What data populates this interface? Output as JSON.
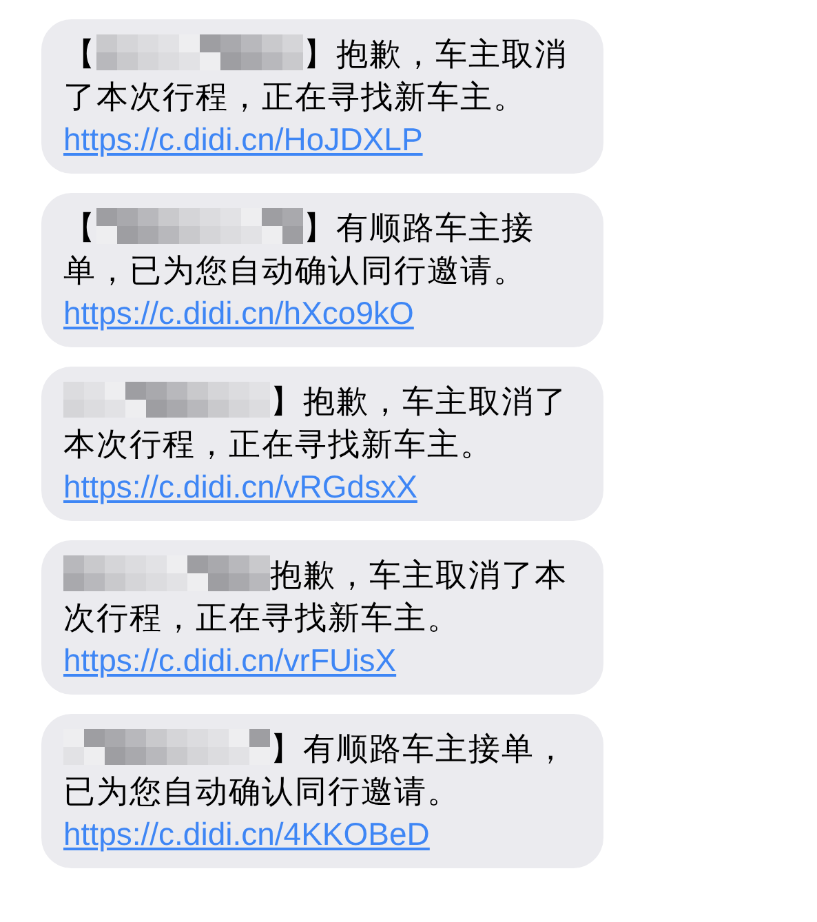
{
  "messages": [
    {
      "open_bracket": "【",
      "close_bracket": "】",
      "text": "抱歉，车主取消了本次行程，正在寻找新车主。",
      "link": "https://c.didi.cn/HoJDXLP"
    },
    {
      "open_bracket": "【",
      "close_bracket": "】",
      "text": "有顺路车主接单，已为您自动确认同行邀请。",
      "link": "https://c.didi.cn/hXco9kO"
    },
    {
      "close_bracket": "】",
      "text": "抱歉，车主取消了本次行程，正在寻找新车主。",
      "link": "https://c.didi.cn/vRGdsxX"
    },
    {
      "text": "抱歉，车主取消了本次行程，正在寻找新车主。",
      "link": "https://c.didi.cn/vrFUisX"
    },
    {
      "close_bracket": "】",
      "text": "有顺路车主接单，已为您自动确认同行邀请。",
      "link": "https://c.didi.cn/4KKOBeD"
    }
  ]
}
